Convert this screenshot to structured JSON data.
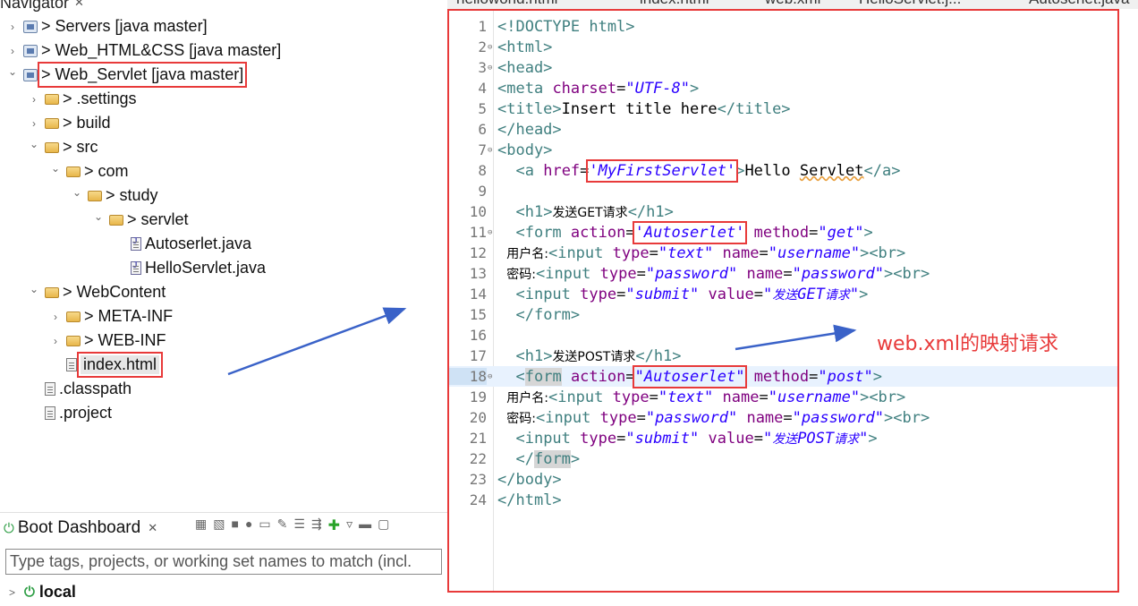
{
  "navigator": {
    "title": "Navigator",
    "close": "✕",
    "tree": [
      {
        "indent": 0,
        "arrow": ">",
        "icon": "project",
        "label": "> Servers [java master]"
      },
      {
        "indent": 0,
        "arrow": ">",
        "icon": "project",
        "label": "> Web_HTML&CSS [java master]"
      },
      {
        "indent": 0,
        "arrow": "v",
        "icon": "project",
        "label": "> Web_Servlet [java master]",
        "boxed": true
      },
      {
        "indent": 1,
        "arrow": ">",
        "icon": "folder",
        "label": "> .settings"
      },
      {
        "indent": 1,
        "arrow": ">",
        "icon": "folder",
        "label": "> build"
      },
      {
        "indent": 1,
        "arrow": "v",
        "icon": "folder",
        "label": "> src"
      },
      {
        "indent": 2,
        "arrow": "v",
        "icon": "folder",
        "label": "> com"
      },
      {
        "indent": 3,
        "arrow": "v",
        "icon": "folder",
        "label": "> study"
      },
      {
        "indent": 4,
        "arrow": "v",
        "icon": "folder",
        "label": "> servlet"
      },
      {
        "indent": 5,
        "arrow": "",
        "icon": "java",
        "label": "Autoserlet.java"
      },
      {
        "indent": 5,
        "arrow": "",
        "icon": "java",
        "label": "HelloServlet.java"
      },
      {
        "indent": 1,
        "arrow": "v",
        "icon": "folder",
        "label": "> WebContent"
      },
      {
        "indent": 2,
        "arrow": ">",
        "icon": "folder",
        "label": "> META-INF"
      },
      {
        "indent": 2,
        "arrow": ">",
        "icon": "folder",
        "label": "> WEB-INF"
      },
      {
        "indent": 2,
        "arrow": "",
        "icon": "file",
        "label": "index.html",
        "boxed": true,
        "selected": true
      },
      {
        "indent": 1,
        "arrow": "",
        "icon": "file",
        "label": ".classpath"
      },
      {
        "indent": 1,
        "arrow": "",
        "icon": "file",
        "label": ".project"
      }
    ]
  },
  "boot_dashboard": {
    "title": "Boot Dashboard",
    "close": "✕",
    "search_placeholder": "Type tags, projects, or working set names to match (incl.",
    "local_label": "local"
  },
  "editor": {
    "tabs": [
      "helloworld.html",
      "index.html",
      "web.xml",
      "HelloServlet.j...",
      "Autoserlet.java"
    ],
    "current_line": 18,
    "lines": [
      {
        "n": 1,
        "fold": "",
        "html": "<span class='tg'>&lt;!DOCTYPE html&gt;</span>"
      },
      {
        "n": 2,
        "fold": "⊖",
        "html": "<span class='tg'>&lt;html&gt;</span>"
      },
      {
        "n": 3,
        "fold": "⊖",
        "html": "<span class='tg'>&lt;head&gt;</span>"
      },
      {
        "n": 4,
        "fold": "",
        "html": "<span class='tg'>&lt;meta</span> <span class='at'>charset</span>=<span class='sv'>\"UTF-8\"</span><span class='tg'>&gt;</span>"
      },
      {
        "n": 5,
        "fold": "",
        "html": "<span class='tg'>&lt;title&gt;</span><span class='tx'>Insert title here</span><span class='tg'>&lt;/title&gt;</span>"
      },
      {
        "n": 6,
        "fold": "",
        "html": "<span class='tg'>&lt;/head&gt;</span>"
      },
      {
        "n": 7,
        "fold": "⊖",
        "html": "<span class='tg'>&lt;body&gt;</span>"
      },
      {
        "n": 8,
        "fold": "",
        "html": "  <span class='tg'>&lt;a</span> <span class='at'>href</span>=<span class='sv redbox'>'MyFirstServlet'</span><span class='tg'>&gt;</span><span class='tx'>Hello <span class='squiggle'>Servlet</span></span><span class='tg'>&lt;/a&gt;</span>"
      },
      {
        "n": 9,
        "fold": "",
        "html": ""
      },
      {
        "n": 10,
        "fold": "",
        "html": "  <span class='tg'>&lt;h1&gt;</span><span class='tx cn'>发送GET请求</span><span class='tg'>&lt;/h1&gt;</span>"
      },
      {
        "n": 11,
        "fold": "⊖",
        "html": "  <span class='tg'>&lt;form</span> <span class='at'>action</span>=<span class='sv redbox'>'Autoserlet'</span> <span class='at'>method</span>=<span class='sv'>\"get\"</span><span class='tg'>&gt;</span>"
      },
      {
        "n": 12,
        "fold": "",
        "html": " <span class='tx cn'>用户名:</span><span class='tg'>&lt;input</span> <span class='at'>type</span>=<span class='sv'>\"text\"</span> <span class='at'>name</span>=<span class='sv'>\"username\"</span><span class='tg'>&gt;&lt;br&gt;</span>"
      },
      {
        "n": 13,
        "fold": "",
        "html": " <span class='tx cn'>密码:</span><span class='tg'>&lt;input</span> <span class='at'>type</span>=<span class='sv'>\"password\"</span> <span class='at'>name</span>=<span class='sv'>\"password\"</span><span class='tg'>&gt;&lt;br&gt;</span>"
      },
      {
        "n": 14,
        "fold": "",
        "html": "  <span class='tg'>&lt;input</span> <span class='at'>type</span>=<span class='sv'>\"submit\"</span> <span class='at'>value</span>=<span class='sv'>\"<span class='cn'>发送</span>GET<span class='cn'>请求</span>\"</span><span class='tg'>&gt;</span>"
      },
      {
        "n": 15,
        "fold": "",
        "html": "  <span class='tg'>&lt;/form&gt;</span>"
      },
      {
        "n": 16,
        "fold": "",
        "html": ""
      },
      {
        "n": 17,
        "fold": "",
        "html": "  <span class='tg'>&lt;h1&gt;</span><span class='tx cn'>发送POST请求</span><span class='tg'>&lt;/h1&gt;</span>"
      },
      {
        "n": 18,
        "fold": "⊖",
        "html": "  <span class='tg'>&lt;<span class='mark'>form</span></span> <span class='at'>action</span>=<span class='sv redbox'>\"Autoserlet\"</span> <span class='at'>method</span>=<span class='sv'>\"post\"</span><span class='tg'>&gt;</span>"
      },
      {
        "n": 19,
        "fold": "",
        "html": " <span class='tx cn'>用户名:</span><span class='tg'>&lt;input</span> <span class='at'>type</span>=<span class='sv'>\"text\"</span> <span class='at'>name</span>=<span class='sv'>\"username\"</span><span class='tg'>&gt;&lt;br&gt;</span>"
      },
      {
        "n": 20,
        "fold": "",
        "html": " <span class='tx cn'>密码:</span><span class='tg'>&lt;input</span> <span class='at'>type</span>=<span class='sv'>\"password\"</span> <span class='at'>name</span>=<span class='sv'>\"password\"</span><span class='tg'>&gt;&lt;br&gt;</span>"
      },
      {
        "n": 21,
        "fold": "",
        "html": "  <span class='tg'>&lt;input</span> <span class='at'>type</span>=<span class='sv'>\"submit\"</span> <span class='at'>value</span>=<span class='sv'>\"<span class='cn'>发送</span>POST<span class='cn'>请求</span>\"</span><span class='tg'>&gt;</span>"
      },
      {
        "n": 22,
        "fold": "",
        "html": "  <span class='tg'>&lt;/<span class='mark'>form</span>&gt;</span>"
      },
      {
        "n": 23,
        "fold": "",
        "html": "<span class='tg'>&lt;/body&gt;</span>"
      },
      {
        "n": 24,
        "fold": "",
        "html": "<span class='tg'>&lt;/html&gt;</span>"
      }
    ]
  },
  "annotation": {
    "text": "web.xml的映射请求",
    "color": "#e83a3a"
  },
  "colors": {
    "highlight_box": "#e83a3a",
    "arrow": "#3a62c8",
    "tag": "#3f7f7f",
    "attribute": "#7f007f",
    "string": "#2a00ff"
  }
}
